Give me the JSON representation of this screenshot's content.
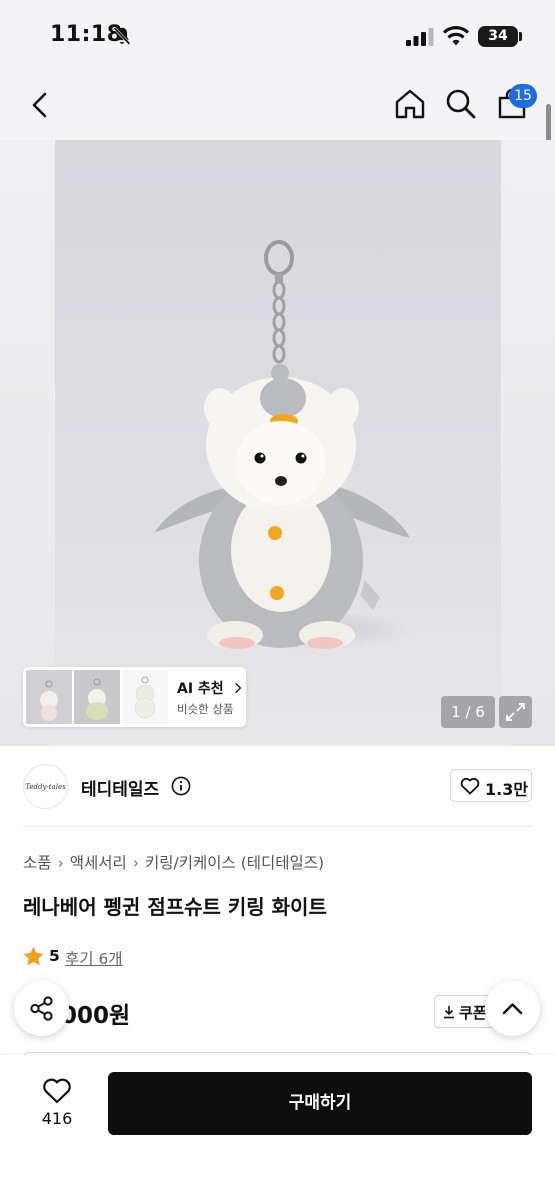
{
  "status_bar": {
    "time": "11:18",
    "battery": "34",
    "icons": [
      "bell-slash-icon",
      "signal-icon",
      "wifi-icon",
      "battery-icon"
    ]
  },
  "header": {
    "icons": [
      "back-icon",
      "home-icon",
      "search-icon",
      "cart-icon"
    ],
    "cart_badge": "15"
  },
  "gallery": {
    "ai_title": "AI 추천",
    "ai_subtitle": "비슷한 상품",
    "page_indicator": "1 / 6",
    "current_page": 1,
    "total_pages": 6
  },
  "shop": {
    "logo_text": "Teddy-tales",
    "name": "테디테일즈",
    "like_count": "1.3만"
  },
  "breadcrumb": [
    "소품",
    "액세서리",
    "키링/키케이스 (테디테일즈)"
  ],
  "product": {
    "title": "레나베어 펭귄 점프슈트 키링 화이트",
    "rating": "5",
    "reviews": "후기 6개",
    "price_partial": "000원",
    "coupon_label": "쿠폰"
  },
  "bottom_bar": {
    "wish_count": "416",
    "buy_label": "구매하기"
  },
  "colors": {
    "accent_blue": "#1e6ce3",
    "star": "#f59e1b",
    "buy_button": "#0d0d0d",
    "penguin_buttons": "#f2a81d"
  }
}
